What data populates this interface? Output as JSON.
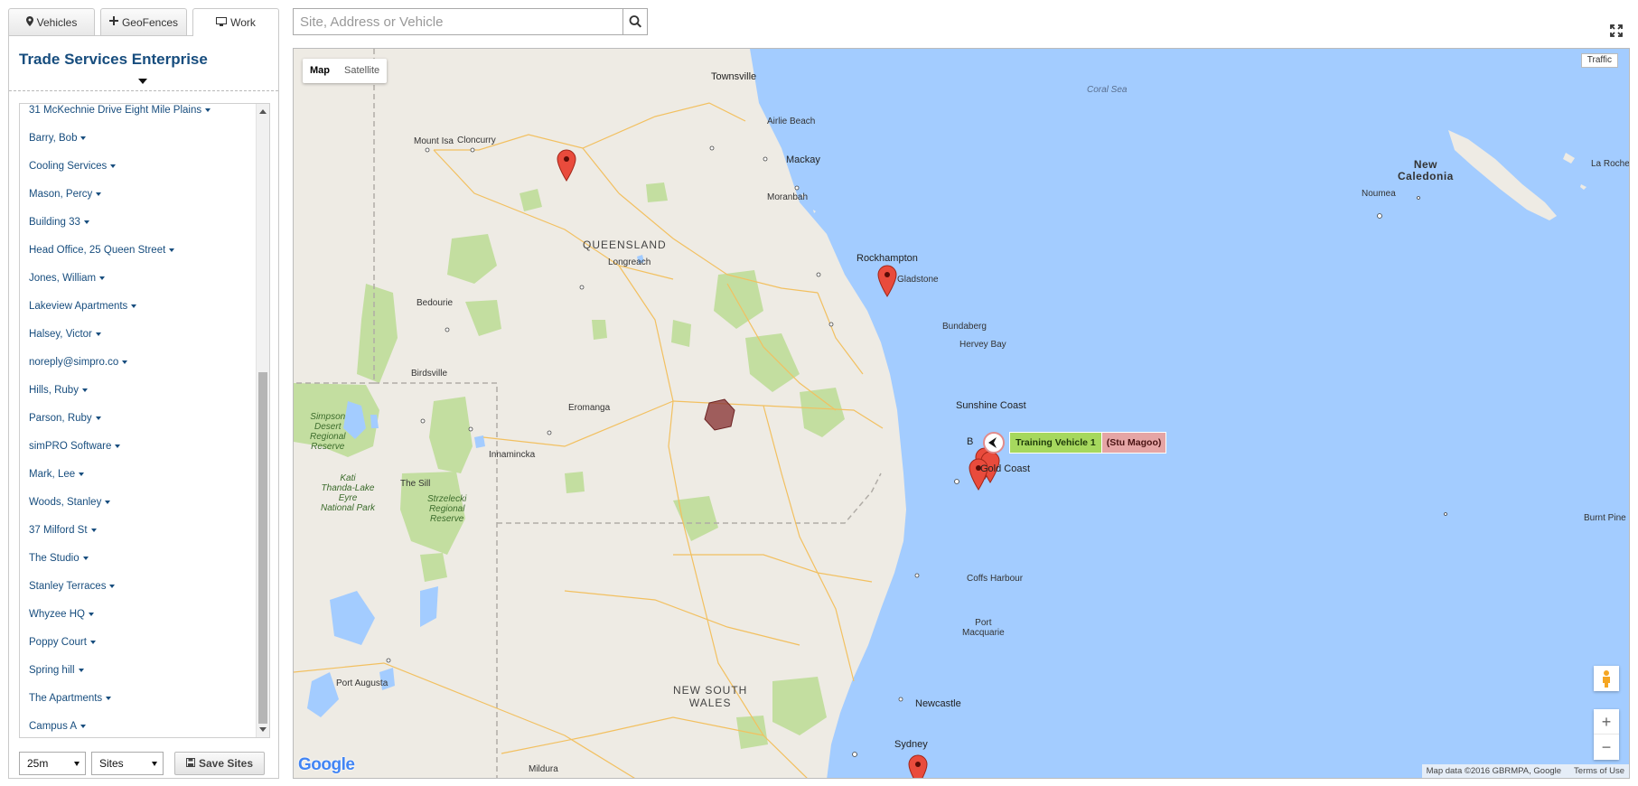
{
  "tabs": [
    {
      "label": "Vehicles",
      "icon": "map-marker-icon"
    },
    {
      "label": "GeoFences",
      "icon": "crosshair-icon"
    },
    {
      "label": "Work",
      "icon": "monitor-icon",
      "active": true
    }
  ],
  "company": "Trade Services Enterprise",
  "sites": [
    "31 McKechnie Drive Eight Mile Plains",
    "Barry, Bob",
    "Cooling Services",
    "Mason, Percy",
    "Building 33",
    "Head Office, 25 Queen Street",
    "Jones, William",
    "Lakeview Apartments",
    "Halsey, Victor",
    "noreply@simpro.co",
    "Hills, Ruby",
    "Parson, Ruby",
    "simPRO Software",
    "Mark, Lee",
    "Woods, Stanley",
    "37 Milford St",
    "The Studio",
    "Stanley Terraces",
    "Whyzee HQ",
    "Poppy Court",
    "Spring hill",
    "The Apartments",
    "Campus A"
  ],
  "controls": {
    "interval": "25m",
    "type": "Sites",
    "save_label": "Save Sites"
  },
  "search": {
    "placeholder": "Site, Address or Vehicle"
  },
  "map": {
    "type_map": "Map",
    "type_satellite": "Satellite",
    "traffic": "Traffic",
    "attribution": "Map data ©2016 GBRMPA, Google",
    "terms": "Terms of Use",
    "logo": "Google",
    "labels": {
      "coral_sea": "Coral Sea",
      "townsville": "Townsville",
      "airlie_beach": "Airlie Beach",
      "mackay": "Mackay",
      "moranbah": "Moranbah",
      "mount_isa": "Mount Isa",
      "cloncurry": "Cloncurry",
      "queensland": "QUEENSLAND",
      "longreach": "Longreach",
      "rockhampton": "Rockhampton",
      "gladstone": "Gladstone",
      "bedourie": "Bedourie",
      "bundaberg": "Bundaberg",
      "hervey_bay": "Hervey Bay",
      "birdsville": "Birdsville",
      "sunshine_coast": "Sunshine Coast",
      "eromanga": "Eromanga",
      "simpson": "Simpson\nDesert\nRegional\nReserve",
      "innamincka": "Innamincka",
      "kati_thanda": "Kati\nThanda-Lake\nEyre\nNational Park",
      "the_sill": "The Sill",
      "strzelecki": "Strzelecki\nRegional\nReserve",
      "brisbane_partial": "B",
      "gold_coast": "Gold Coast",
      "coffs_harbour": "Coffs Harbour",
      "port_macquarie": "Port\nMacquarie",
      "port_augusta": "Port Augusta",
      "nsw": "NEW SOUTH\nWALES",
      "newcastle": "Newcastle",
      "sydney": "Sydney",
      "mildura": "Mildura",
      "new_caledonia": "New\nCaledonia",
      "noumea": "Noumea",
      "la_roche": "La Roche",
      "burnt_pine": "Burnt Pine"
    },
    "vehicle": {
      "name": "Training Vehicle 1",
      "driver": "(Stu Magoo)"
    }
  }
}
